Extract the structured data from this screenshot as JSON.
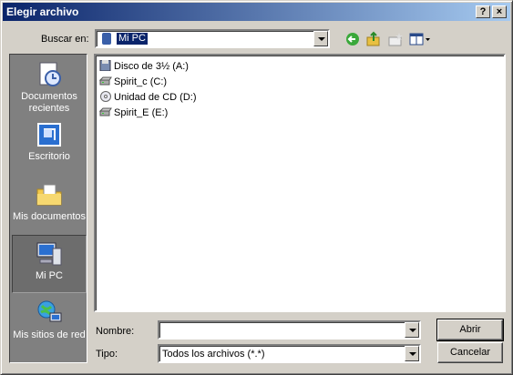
{
  "window": {
    "title": "Elegir archivo",
    "help_label": "?",
    "close_label": "×"
  },
  "lookin": {
    "label": "Buscar en:",
    "value": "Mi PC"
  },
  "toolbar": {
    "back": "back-icon",
    "up": "up-folder-icon",
    "new_folder": "new-folder-icon",
    "views": "views-menu-icon"
  },
  "places": [
    {
      "label": "Documentos recientes",
      "icon": "recent-documents-icon"
    },
    {
      "label": "Escritorio",
      "icon": "desktop-icon"
    },
    {
      "label": "Mis documentos",
      "icon": "my-documents-icon"
    },
    {
      "label": "Mi PC",
      "icon": "my-computer-icon",
      "selected": true
    },
    {
      "label": "Mis sitios de red",
      "icon": "network-places-icon"
    }
  ],
  "files": [
    {
      "label": "Disco de 3½ (A:)",
      "icon": "floppy-icon"
    },
    {
      "label": "Spirit_c (C:)",
      "icon": "hard-drive-icon"
    },
    {
      "label": "Unidad de CD (D:)",
      "icon": "cd-drive-icon"
    },
    {
      "label": "Spirit_E (E:)",
      "icon": "hard-drive-icon"
    }
  ],
  "filename": {
    "label": "Nombre:",
    "value": ""
  },
  "filetype": {
    "label": "Tipo:",
    "value": "Todos los archivos (*.*)"
  },
  "buttons": {
    "open": "Abrir",
    "cancel": "Cancelar"
  }
}
